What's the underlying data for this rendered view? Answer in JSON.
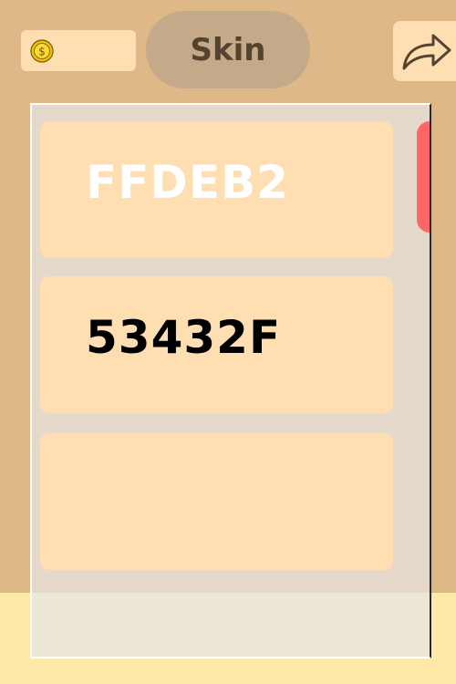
{
  "header": {
    "title": "Skin",
    "coin": {
      "icon": "coin-icon",
      "count": ""
    },
    "share_icon": "share-arrow-icon"
  },
  "skins": [
    {
      "label": "FFDEB2",
      "label_color": "#FFFFFF"
    },
    {
      "label": "53432F",
      "label_color": "#000000"
    },
    {
      "label": "",
      "label_color": "#000000"
    }
  ],
  "colors": {
    "background": "#DEB887",
    "card": "#FFDEB2",
    "title_pill": "#C4AA88",
    "text_dark": "#53432F",
    "scrollbar_thumb": "#FF6666",
    "bottom_band": "#FFE9A8"
  }
}
